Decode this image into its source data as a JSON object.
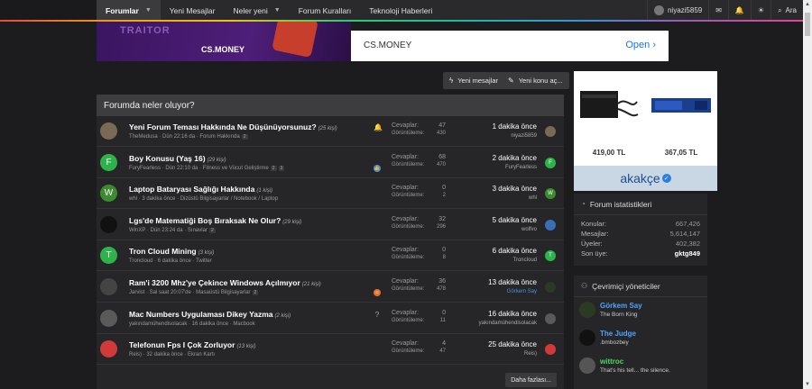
{
  "nav": {
    "tabs": [
      {
        "label": "Forumlar",
        "caret": true
      },
      {
        "label": "Yeni Mesajlar",
        "caret": false
      },
      {
        "label": "Neler yeni",
        "caret": true
      },
      {
        "label": "Forum Kuralları",
        "caret": false
      },
      {
        "label": "Teknoloji Haberleri",
        "caret": false
      }
    ],
    "username": "niyazi5859",
    "search_label": "Ara"
  },
  "banner": {
    "left_word": "TRAITOR",
    "left_brand": "CS.MONEY",
    "right_title": "CS.MONEY",
    "right_cta": "Open"
  },
  "actions": {
    "new_posts": "Yeni mesajlar",
    "new_thread": "Yeni konu aç..."
  },
  "panel": {
    "title": "Forumda neler oluyor?",
    "more_label": "Daha fazlası...",
    "labels": {
      "replies": "Cevaplar:",
      "views": "Görüntüleme:"
    },
    "threads": [
      {
        "title": "Yeni Forum Teması Hakkında Ne Düşünüyorsunuz?",
        "rep": "(25 kişi)",
        "meta": "TheMedusa · Dün 22:16 da · Forum Hakkında",
        "pages": [
          "2"
        ],
        "flag": "bell",
        "replies": "47",
        "views": "430",
        "when": "1 dakika önce",
        "who": "niyazi5859",
        "who_blue": false,
        "avatar": "",
        "avatar_color": "#7a6a55",
        "last_avatar": "",
        "last_avatar_color": "#7a6a55"
      },
      {
        "title": "Boy Konusu (Yaş 16)",
        "rep": "(29 kişi)",
        "meta": "FuryFearless · Dün 22:10 da · Fitness ve Vücut Geliştirme",
        "pages": [
          "2",
          "3"
        ],
        "flag": "like",
        "replies": "68",
        "views": "470",
        "when": "2 dakika önce",
        "who": "FuryFearless",
        "who_blue": false,
        "avatar": "F",
        "avatar_color": "#2db34a",
        "last_avatar": "F",
        "last_avatar_color": "#2db34a"
      },
      {
        "title": "Laptop Bataryası Sağlığı Hakkında",
        "rep": "(1 kişi)",
        "meta": "whl · 3 dakika önce · Dizüstü Bilgisayarlar / Notebook / Laptop",
        "pages": [],
        "flag": "",
        "replies": "0",
        "views": "2",
        "when": "3 dakika önce",
        "who": "whl",
        "who_blue": false,
        "avatar": "W",
        "avatar_color": "#3a8c2f",
        "last_avatar": "W",
        "last_avatar_color": "#3a8c2f"
      },
      {
        "title": "Lgs'de Matematiği Boş Bıraksak Ne Olur?",
        "rep": "(29 kişi)",
        "meta": "WinXP · Dün 23:24 da · Sınavlar",
        "pages": [
          "2"
        ],
        "flag": "",
        "replies": "32",
        "views": "296",
        "when": "5 dakika önce",
        "who": "wolfvo",
        "who_blue": false,
        "avatar": "",
        "avatar_color": "#111111",
        "last_avatar": "",
        "last_avatar_color": "#3a6fb5"
      },
      {
        "title": "Tron Cloud Mining",
        "rep": "(3 kişi)",
        "meta": "Troncloud · 6 dakika önce · Twitter",
        "pages": [],
        "flag": "",
        "replies": "0",
        "views": "8",
        "when": "6 dakika önce",
        "who": "Troncloud",
        "who_blue": false,
        "avatar": "T",
        "avatar_color": "#2db34a",
        "last_avatar": "T",
        "last_avatar_color": "#2db34a"
      },
      {
        "title": "Ram'i 3200 Mhz'ye Çekince Windows Açılmıyor",
        "rep": "(21 kişi)",
        "meta": "Jarvist · Sal saat 20:07'de · Masaüstü Bilgisayarlar",
        "pages": [
          "2"
        ],
        "flag": "haha",
        "replies": "36",
        "views": "478",
        "when": "13 dakika önce",
        "who": "Görkem Say",
        "who_blue": true,
        "avatar": "",
        "avatar_color": "#444444",
        "last_avatar": "",
        "last_avatar_color": "#2b3a22"
      },
      {
        "title": "Mac Numbers Uygulaması Dikey Yazma",
        "rep": "(2 kişi)",
        "meta": "yakındamühendisolacak · 16 dakika önce · Macbook",
        "pages": [],
        "flag": "question",
        "replies": "0",
        "views": "11",
        "when": "16 dakika önce",
        "who": "yakındamühendisolacak",
        "who_blue": false,
        "avatar": "",
        "avatar_color": "#5a5a5a",
        "last_avatar": "",
        "last_avatar_color": "#5a5a5a"
      },
      {
        "title": "Telefonun Fps I Çok Zorluyor",
        "rep": "(13 kişi)",
        "meta": "Reis) · 32 dakika önce · Ekran Kartı",
        "pages": [],
        "flag": "",
        "replies": "4",
        "views": "47",
        "when": "25 dakika önce",
        "who": "Reis)",
        "who_blue": false,
        "avatar": "",
        "avatar_color": "#d23a3a",
        "last_avatar": "",
        "last_avatar_color": "#d23a3a"
      }
    ]
  },
  "ad": {
    "products": [
      {
        "price": "419,00 TL"
      },
      {
        "price": "367,05 TL"
      }
    ],
    "brand": "akakçe"
  },
  "forum_stats": {
    "title": "Forum istatistikleri",
    "rows": [
      {
        "label": "Konular:",
        "value": "667,426",
        "bold": false
      },
      {
        "label": "Mesajlar:",
        "value": "5,614,147",
        "bold": false
      },
      {
        "label": "Üyeler:",
        "value": "402,382",
        "bold": false
      },
      {
        "label": "Son üye:",
        "value": "gktg849",
        "bold": true
      }
    ]
  },
  "online_staff": {
    "title": "Çevrimiçi yöneticiler",
    "members": [
      {
        "name": "Görkem Say",
        "role": "The Born King",
        "color": "blue",
        "avatar_color": "#2b3a22"
      },
      {
        "name": "The Judge",
        "role": ".bmbozbey",
        "color": "blue",
        "avatar_color": "#111111"
      },
      {
        "name": "wittroc",
        "role": "That's his tell... the silence.",
        "color": "green",
        "avatar_color": "#555555"
      }
    ]
  }
}
